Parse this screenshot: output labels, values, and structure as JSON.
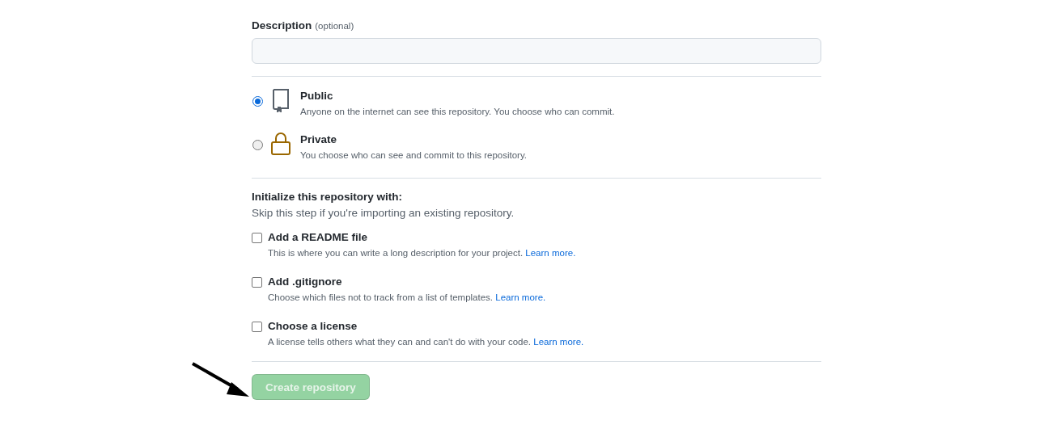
{
  "description": {
    "label": "Description",
    "hint": "(optional)"
  },
  "visibility": [
    {
      "kind": "repo",
      "title": "Public",
      "text": "Anyone on the internet can see this repository. You choose who can commit.",
      "selected": true
    },
    {
      "kind": "lock",
      "title": "Private",
      "text": "You choose who can see and commit to this repository.",
      "selected": false
    }
  ],
  "initialize": {
    "heading": "Initialize this repository with:",
    "note": "Skip this step if you're importing an existing repository.",
    "options": [
      {
        "label": "Add a README file",
        "text": "This is where you can write a long description for your project.",
        "link": "Learn more.",
        "checked": false
      },
      {
        "label": "Add .gitignore",
        "text": "Choose which files not to track from a list of templates.",
        "link": "Learn more.",
        "checked": false
      },
      {
        "label": "Choose a license",
        "text": "A license tells others what they can and can't do with your code.",
        "link": "Learn more.",
        "checked": false
      }
    ]
  },
  "submit": {
    "label": "Create repository",
    "disabled": true
  }
}
